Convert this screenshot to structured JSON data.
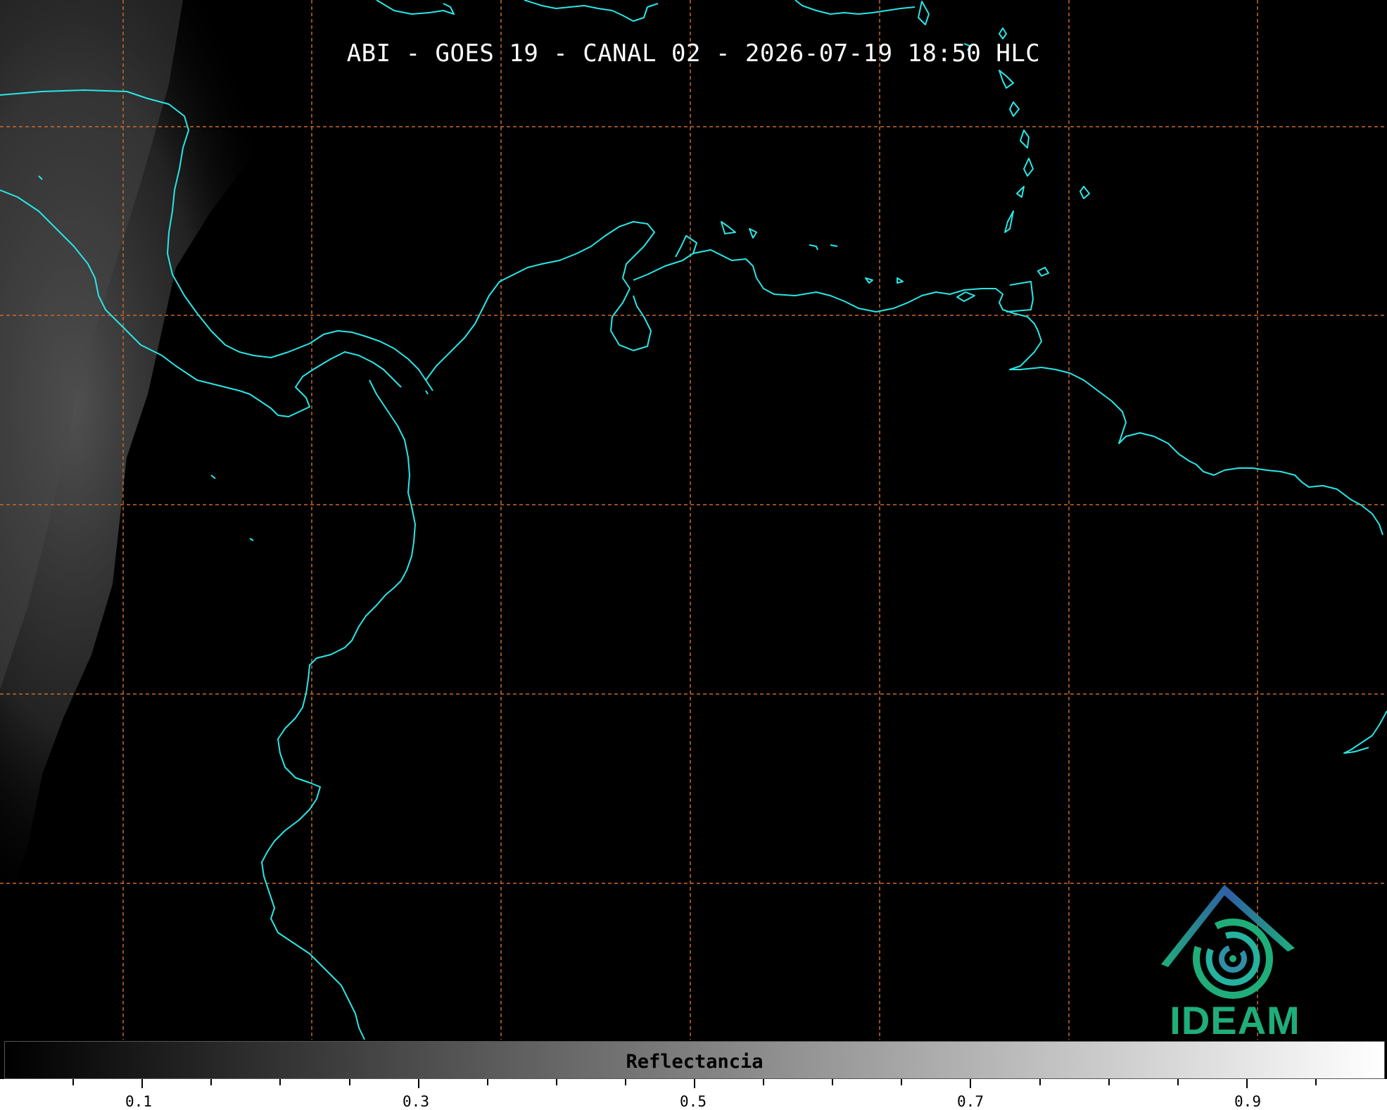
{
  "title": "ABI - GOES 19 - CANAL 02 - 2026-07-19 18:50 HLC",
  "colors": {
    "background": "#000000",
    "coastline": "#29e6e6",
    "gridline": "#c8692a",
    "logo_blue": "#2f5fa6",
    "logo_green": "#1fae7a"
  },
  "map": {
    "gridlines": "dashed, orange",
    "coastlines": "cyan"
  },
  "colorbar": {
    "label": "Reflectancia",
    "range": [
      0.0,
      1.0
    ],
    "ticks": [
      "0.1",
      "0.3",
      "0.5",
      "0.7",
      "0.9"
    ],
    "gradient": "black to white"
  },
  "logo": {
    "text": "IDEAM",
    "icon": "ideam-swirl-roof-icon"
  }
}
